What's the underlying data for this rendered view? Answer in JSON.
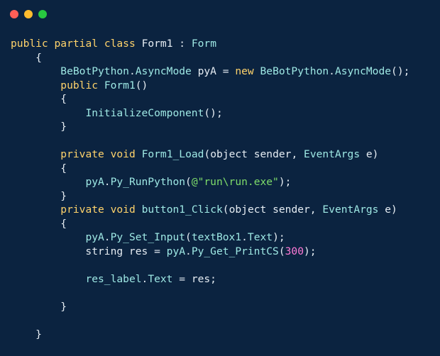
{
  "window": {
    "controls": [
      "close",
      "minimize",
      "maximize"
    ],
    "colors": {
      "background": "#0b2340",
      "close": "#ff5f57",
      "minimize": "#febc2e",
      "maximize": "#28c840"
    }
  },
  "code": {
    "language": "csharp",
    "lines": [
      [
        {
          "t": "public",
          "c": "kw"
        },
        {
          "t": " ",
          "c": "txt"
        },
        {
          "t": "partial",
          "c": "kw"
        },
        {
          "t": " ",
          "c": "txt"
        },
        {
          "t": "class",
          "c": "kw"
        },
        {
          "t": " ",
          "c": "txt"
        },
        {
          "t": "Form1",
          "c": "txt"
        },
        {
          "t": " : ",
          "c": "txt"
        },
        {
          "t": "Form",
          "c": "cls"
        }
      ],
      [
        {
          "t": "    {",
          "c": "txt"
        }
      ],
      [
        {
          "t": "        ",
          "c": "txt"
        },
        {
          "t": "BeBotPython",
          "c": "cls"
        },
        {
          "t": ".",
          "c": "punc"
        },
        {
          "t": "AsyncMode",
          "c": "cls"
        },
        {
          "t": " pyA = ",
          "c": "txt"
        },
        {
          "t": "new",
          "c": "kw"
        },
        {
          "t": " ",
          "c": "txt"
        },
        {
          "t": "BeBotPython",
          "c": "cls"
        },
        {
          "t": ".",
          "c": "punc"
        },
        {
          "t": "AsyncMode",
          "c": "cls"
        },
        {
          "t": "();",
          "c": "txt"
        }
      ],
      [
        {
          "t": "        ",
          "c": "txt"
        },
        {
          "t": "public",
          "c": "kw"
        },
        {
          "t": " ",
          "c": "txt"
        },
        {
          "t": "Form1",
          "c": "cls"
        },
        {
          "t": "()",
          "c": "txt"
        }
      ],
      [
        {
          "t": "        {",
          "c": "txt"
        }
      ],
      [
        {
          "t": "            ",
          "c": "txt"
        },
        {
          "t": "InitializeComponent",
          "c": "cls"
        },
        {
          "t": "();",
          "c": "txt"
        }
      ],
      [
        {
          "t": "        }",
          "c": "txt"
        }
      ],
      [
        {
          "t": "",
          "c": "txt"
        }
      ],
      [
        {
          "t": "        ",
          "c": "txt"
        },
        {
          "t": "private",
          "c": "kw"
        },
        {
          "t": " ",
          "c": "txt"
        },
        {
          "t": "void",
          "c": "kw"
        },
        {
          "t": " ",
          "c": "txt"
        },
        {
          "t": "Form1_Load",
          "c": "cls"
        },
        {
          "t": "(object sender, ",
          "c": "txt"
        },
        {
          "t": "EventArgs",
          "c": "cls"
        },
        {
          "t": " e)",
          "c": "txt"
        }
      ],
      [
        {
          "t": "        {",
          "c": "txt"
        }
      ],
      [
        {
          "t": "            ",
          "c": "txt"
        },
        {
          "t": "pyA",
          "c": "cls"
        },
        {
          "t": ".",
          "c": "punc"
        },
        {
          "t": "Py_RunPython",
          "c": "cls"
        },
        {
          "t": "(",
          "c": "txt"
        },
        {
          "t": "@\"run\\run.exe\"",
          "c": "str"
        },
        {
          "t": ");",
          "c": "txt"
        }
      ],
      [
        {
          "t": "        }",
          "c": "txt"
        }
      ],
      [
        {
          "t": "        ",
          "c": "txt"
        },
        {
          "t": "private",
          "c": "kw"
        },
        {
          "t": " ",
          "c": "txt"
        },
        {
          "t": "void",
          "c": "kw"
        },
        {
          "t": " ",
          "c": "txt"
        },
        {
          "t": "button1_Click",
          "c": "cls"
        },
        {
          "t": "(object sender, ",
          "c": "txt"
        },
        {
          "t": "EventArgs",
          "c": "cls"
        },
        {
          "t": " e)",
          "c": "txt"
        }
      ],
      [
        {
          "t": "        {",
          "c": "txt"
        }
      ],
      [
        {
          "t": "            ",
          "c": "txt"
        },
        {
          "t": "pyA",
          "c": "cls"
        },
        {
          "t": ".",
          "c": "punc"
        },
        {
          "t": "Py_Set_Input",
          "c": "cls"
        },
        {
          "t": "(",
          "c": "txt"
        },
        {
          "t": "textBox1",
          "c": "cls"
        },
        {
          "t": ".",
          "c": "punc"
        },
        {
          "t": "Text",
          "c": "cls"
        },
        {
          "t": ");",
          "c": "txt"
        }
      ],
      [
        {
          "t": "            string res = ",
          "c": "txt"
        },
        {
          "t": "pyA",
          "c": "cls"
        },
        {
          "t": ".",
          "c": "punc"
        },
        {
          "t": "Py_Get_PrintCS",
          "c": "cls"
        },
        {
          "t": "(",
          "c": "txt"
        },
        {
          "t": "300",
          "c": "num"
        },
        {
          "t": ");",
          "c": "txt"
        }
      ],
      [
        {
          "t": "",
          "c": "txt"
        }
      ],
      [
        {
          "t": "            ",
          "c": "txt"
        },
        {
          "t": "res_label",
          "c": "cls"
        },
        {
          "t": ".",
          "c": "punc"
        },
        {
          "t": "Text",
          "c": "cls"
        },
        {
          "t": " = res;",
          "c": "txt"
        }
      ],
      [
        {
          "t": "",
          "c": "txt"
        }
      ],
      [
        {
          "t": "        }",
          "c": "txt"
        }
      ],
      [
        {
          "t": "",
          "c": "txt"
        }
      ],
      [
        {
          "t": "    }",
          "c": "txt"
        }
      ]
    ]
  }
}
